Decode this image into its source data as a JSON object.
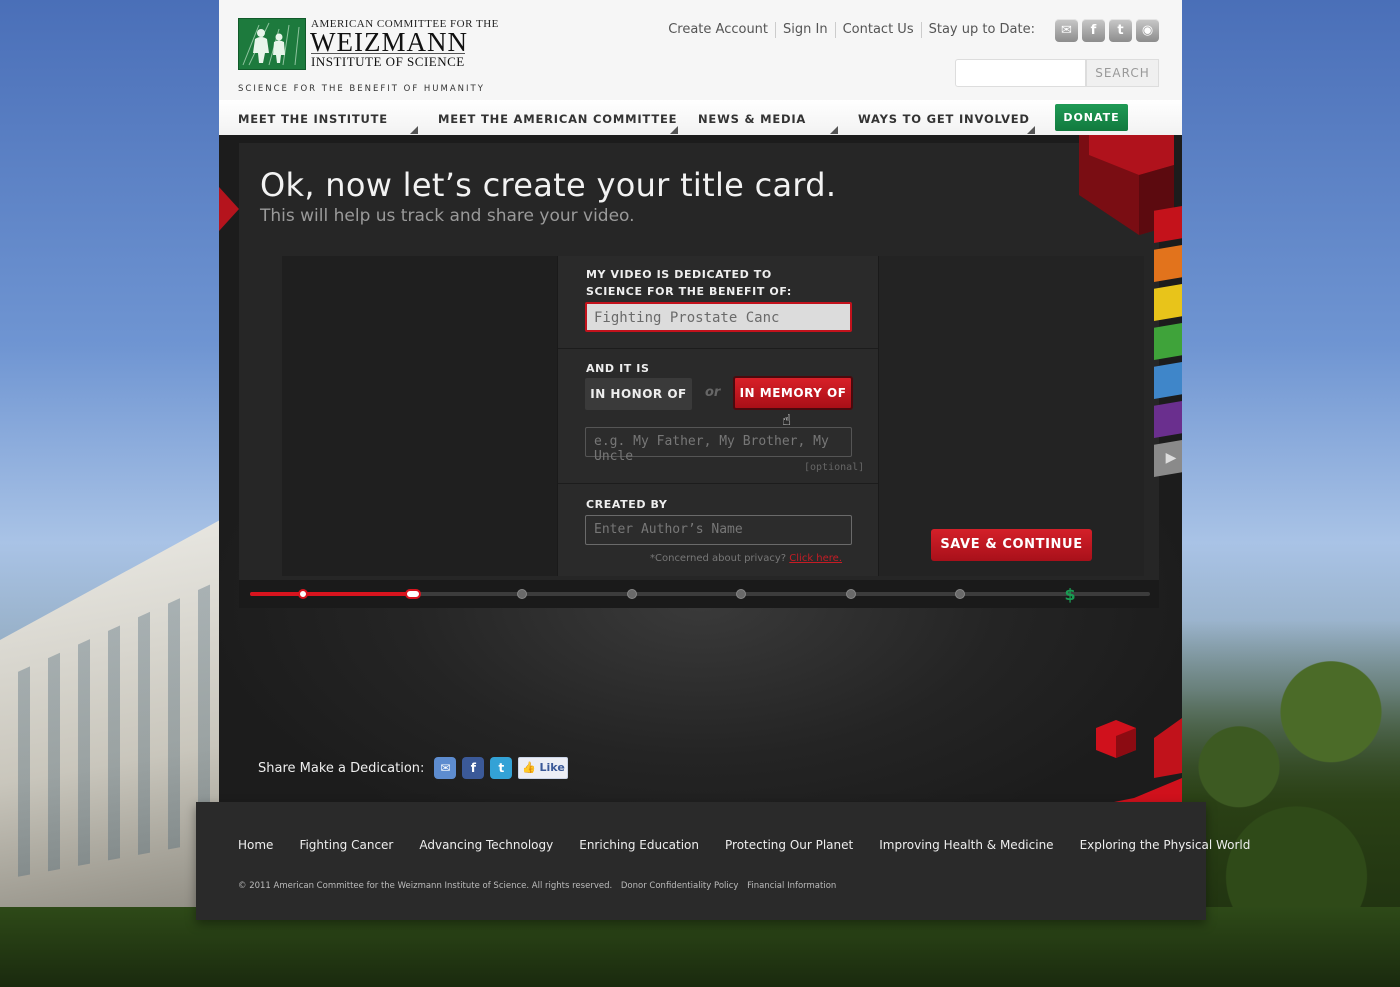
{
  "header": {
    "logo": {
      "line1": "AMERICAN COMMITTEE FOR THE",
      "line2": "WEIZMANN",
      "line3": "INSTITUTE OF SCIENCE",
      "tagline": "SCIENCE FOR THE BENEFIT OF HUMANITY"
    },
    "top_links": [
      "Create Account",
      "Sign In",
      "Contact Us",
      "Stay up to Date:"
    ],
    "social": [
      {
        "icon": "email-icon",
        "glyph": "✉",
        "color": "#a9a9a9"
      },
      {
        "icon": "facebook-icon",
        "glyph": "f",
        "color": "#a9a9a9"
      },
      {
        "icon": "twitter-icon",
        "glyph": "t",
        "color": "#a9a9a9"
      },
      {
        "icon": "rss-icon",
        "glyph": "◉",
        "color": "#a9a9a9"
      }
    ],
    "search": {
      "value": "",
      "button_label": "SEARCH"
    }
  },
  "nav": {
    "items": [
      "MEET THE INSTITUTE",
      "MEET THE AMERICAN COMMITTEE",
      "NEWS & MEDIA",
      "WAYS TO GET INVOLVED"
    ],
    "donate_label": "DONATE"
  },
  "stage": {
    "title": "Ok, now let’s create your title card.",
    "subtitle": "This will help us track and share your video.",
    "form": {
      "dedicated_label_1": "MY VIDEO IS DEDICATED TO",
      "dedicated_label_2": "SCIENCE FOR THE BENEFIT OF:",
      "dedicated_value": "Fighting Prostate Canc",
      "and_it_is_label": "AND IT IS",
      "honor_label": "IN HONOR OF",
      "or_label": "or",
      "memory_label": "IN MEMORY OF",
      "person_placeholder": "e.g. My Father, My Brother, My Uncle",
      "optional_label": "[optional]",
      "created_by_label": "CREATED BY",
      "author_placeholder": "Enter Author’s Name",
      "privacy_text": "*Concerned about privacy?",
      "privacy_link": "Click here."
    },
    "save_label": "SAVE & CONTINUE",
    "progress": {
      "current_step": 2,
      "total_steps": 8,
      "final_glyph": "$"
    },
    "color_tabs": [
      "#c4121b",
      "#e2731c",
      "#e8c41a",
      "#3fa33a",
      "#3f86c9",
      "#6a2f8e",
      "#8a8a8a"
    ],
    "share": {
      "label": "Share Make a Dedication:",
      "like_label": "Like"
    }
  },
  "footer": {
    "links": [
      "Home",
      "Fighting Cancer",
      "Advancing Technology",
      "Enriching Education",
      "Protecting Our Planet",
      "Improving Health & Medicine",
      "Exploring the Physical World"
    ],
    "copyright": "© 2011 American Committee for the Weizmann Institute of Science. All rights reserved.",
    "legal_links": [
      "Donor Confidentiality Policy",
      "Financial Information"
    ]
  }
}
